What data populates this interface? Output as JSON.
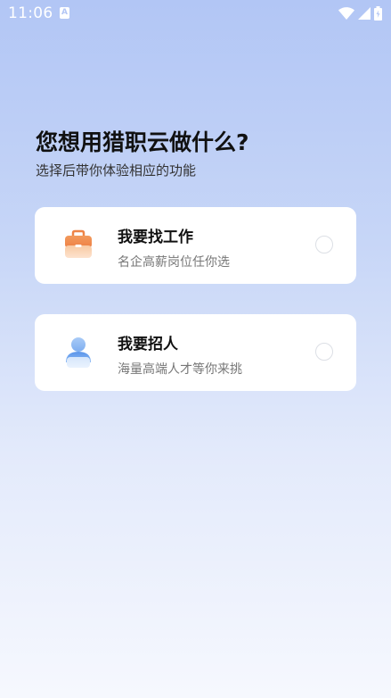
{
  "status_bar": {
    "time": "11:06",
    "notification_icon": "A",
    "icons": [
      "wifi-icon",
      "signal-icon",
      "battery-icon"
    ]
  },
  "page": {
    "title": "您想用猎职云做什么?",
    "subtitle": "选择后带你体验相应的功能"
  },
  "options": [
    {
      "id": "find-job",
      "title": "我要找工作",
      "description": "名企高薪岗位任你选",
      "icon": "briefcase-icon",
      "selected": false
    },
    {
      "id": "hire",
      "title": "我要招人",
      "description": "海量高端人才等你来挑",
      "icon": "person-icon",
      "selected": false
    }
  ],
  "colors": {
    "background_top": "#b2c6f5",
    "background_bottom": "#f6f8fe",
    "card": "#ffffff",
    "briefcase_orange": "#f0894d",
    "person_blue": "#6fa4ee"
  }
}
